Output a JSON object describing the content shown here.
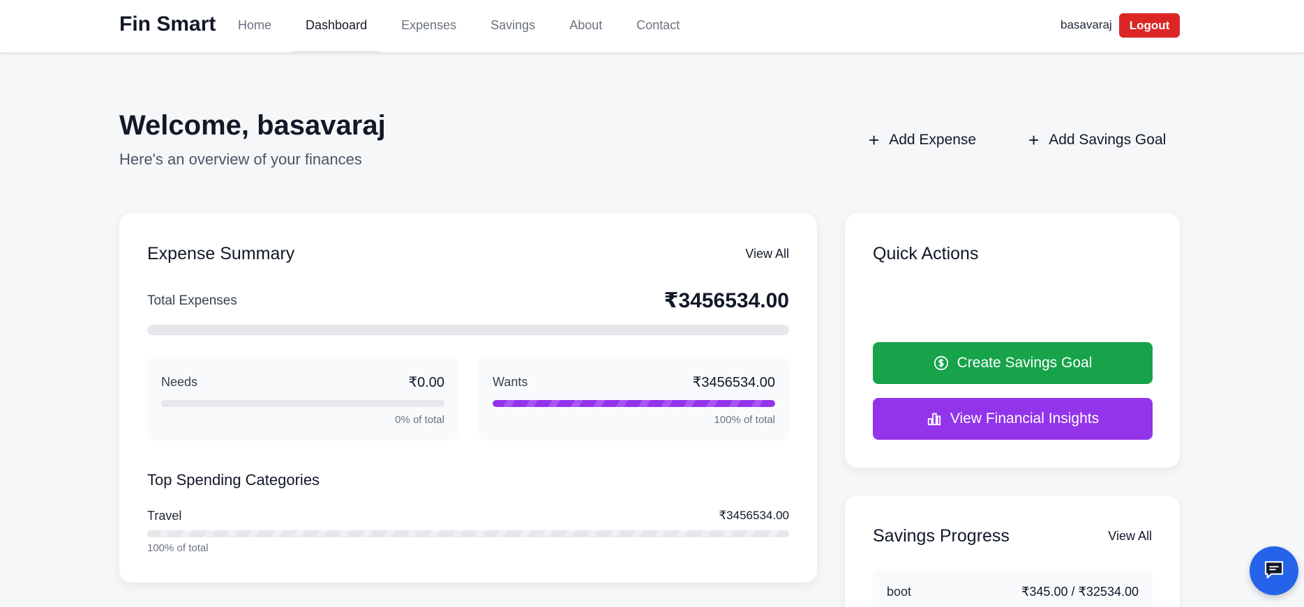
{
  "app": {
    "brand": "Fin Smart"
  },
  "nav": {
    "links": [
      "Home",
      "Dashboard",
      "Expenses",
      "Savings",
      "About",
      "Contact"
    ],
    "active": "Dashboard",
    "user": "basavaraj",
    "logout_label": "Logout"
  },
  "header": {
    "welcome": "Welcome, basavaraj",
    "subtitle": "Here's an overview of your finances",
    "add_expense": "Add Expense",
    "add_savings_goal": "Add Savings Goal"
  },
  "expense_summary": {
    "title": "Expense Summary",
    "view_all": "View All",
    "total_label": "Total Expenses",
    "total_value": "₹3456534.00",
    "total_progress": 0,
    "needs": {
      "label": "Needs",
      "value": "₹0.00",
      "pct_text": "0% of total",
      "progress": 0
    },
    "wants": {
      "label": "Wants",
      "value": "₹3456534.00",
      "pct_text": "100% of total",
      "progress": 1.0
    },
    "top_categories_title": "Top Spending Categories",
    "categories": [
      {
        "name": "Travel",
        "value": "₹3456534.00",
        "pct_text": "100% of total",
        "progress": 1.0
      }
    ]
  },
  "quick_actions": {
    "title": "Quick Actions",
    "create_savings_goal": "Create Savings Goal",
    "view_financial_insights": "View Financial Insights"
  },
  "savings_progress": {
    "title": "Savings Progress",
    "view_all": "View All",
    "goals": [
      {
        "name": "boot",
        "amount": "₹345.00 / ₹32534.00"
      }
    ]
  },
  "icons": {
    "add_expense": "plus-icon",
    "add_savings_goal": "plus-icon",
    "create_savings_goal": "dollar-circle-icon",
    "view_financial_insights": "bar-chart-icon",
    "chat": "chat-icon"
  },
  "colors": {
    "logout": "#dc2626",
    "create_savings_goal": "#16a34a",
    "view_financial_insights": "#9333ea",
    "wants_bar": "#9333ea",
    "chat_button": "#2563eb"
  }
}
